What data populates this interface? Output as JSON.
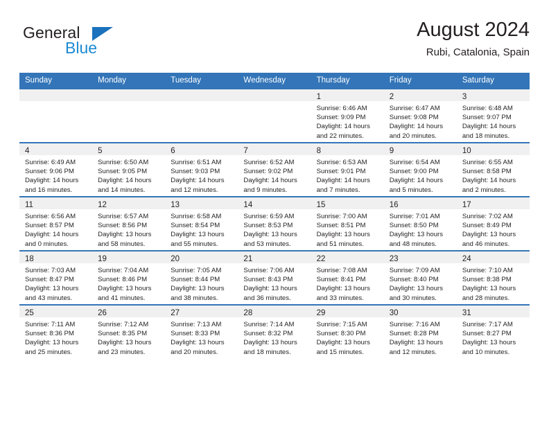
{
  "brand": {
    "name_top": "General",
    "name_bottom": "Blue",
    "accent_color": "#1c72bc",
    "blue_text_color": "#1c8ad1"
  },
  "header": {
    "title": "August 2024",
    "subtitle": "Rubi, Catalonia, Spain"
  },
  "table": {
    "header_bg": "#3375b8",
    "header_text_color": "#ffffff",
    "daynum_band_bg": "#f0f0f0",
    "weekday_headers": [
      "Sunday",
      "Monday",
      "Tuesday",
      "Wednesday",
      "Thursday",
      "Friday",
      "Saturday"
    ]
  },
  "weeks": [
    [
      {
        "empty": true
      },
      {
        "empty": true
      },
      {
        "empty": true
      },
      {
        "empty": true
      },
      {
        "day": "1",
        "sunrise": "Sunrise: 6:46 AM",
        "sunset": "Sunset: 9:09 PM",
        "daylight_1": "Daylight: 14 hours",
        "daylight_2": "and 22 minutes."
      },
      {
        "day": "2",
        "sunrise": "Sunrise: 6:47 AM",
        "sunset": "Sunset: 9:08 PM",
        "daylight_1": "Daylight: 14 hours",
        "daylight_2": "and 20 minutes."
      },
      {
        "day": "3",
        "sunrise": "Sunrise: 6:48 AM",
        "sunset": "Sunset: 9:07 PM",
        "daylight_1": "Daylight: 14 hours",
        "daylight_2": "and 18 minutes."
      }
    ],
    [
      {
        "day": "4",
        "sunrise": "Sunrise: 6:49 AM",
        "sunset": "Sunset: 9:06 PM",
        "daylight_1": "Daylight: 14 hours",
        "daylight_2": "and 16 minutes."
      },
      {
        "day": "5",
        "sunrise": "Sunrise: 6:50 AM",
        "sunset": "Sunset: 9:05 PM",
        "daylight_1": "Daylight: 14 hours",
        "daylight_2": "and 14 minutes."
      },
      {
        "day": "6",
        "sunrise": "Sunrise: 6:51 AM",
        "sunset": "Sunset: 9:03 PM",
        "daylight_1": "Daylight: 14 hours",
        "daylight_2": "and 12 minutes."
      },
      {
        "day": "7",
        "sunrise": "Sunrise: 6:52 AM",
        "sunset": "Sunset: 9:02 PM",
        "daylight_1": "Daylight: 14 hours",
        "daylight_2": "and 9 minutes."
      },
      {
        "day": "8",
        "sunrise": "Sunrise: 6:53 AM",
        "sunset": "Sunset: 9:01 PM",
        "daylight_1": "Daylight: 14 hours",
        "daylight_2": "and 7 minutes."
      },
      {
        "day": "9",
        "sunrise": "Sunrise: 6:54 AM",
        "sunset": "Sunset: 9:00 PM",
        "daylight_1": "Daylight: 14 hours",
        "daylight_2": "and 5 minutes."
      },
      {
        "day": "10",
        "sunrise": "Sunrise: 6:55 AM",
        "sunset": "Sunset: 8:58 PM",
        "daylight_1": "Daylight: 14 hours",
        "daylight_2": "and 2 minutes."
      }
    ],
    [
      {
        "day": "11",
        "sunrise": "Sunrise: 6:56 AM",
        "sunset": "Sunset: 8:57 PM",
        "daylight_1": "Daylight: 14 hours",
        "daylight_2": "and 0 minutes."
      },
      {
        "day": "12",
        "sunrise": "Sunrise: 6:57 AM",
        "sunset": "Sunset: 8:56 PM",
        "daylight_1": "Daylight: 13 hours",
        "daylight_2": "and 58 minutes."
      },
      {
        "day": "13",
        "sunrise": "Sunrise: 6:58 AM",
        "sunset": "Sunset: 8:54 PM",
        "daylight_1": "Daylight: 13 hours",
        "daylight_2": "and 55 minutes."
      },
      {
        "day": "14",
        "sunrise": "Sunrise: 6:59 AM",
        "sunset": "Sunset: 8:53 PM",
        "daylight_1": "Daylight: 13 hours",
        "daylight_2": "and 53 minutes."
      },
      {
        "day": "15",
        "sunrise": "Sunrise: 7:00 AM",
        "sunset": "Sunset: 8:51 PM",
        "daylight_1": "Daylight: 13 hours",
        "daylight_2": "and 51 minutes."
      },
      {
        "day": "16",
        "sunrise": "Sunrise: 7:01 AM",
        "sunset": "Sunset: 8:50 PM",
        "daylight_1": "Daylight: 13 hours",
        "daylight_2": "and 48 minutes."
      },
      {
        "day": "17",
        "sunrise": "Sunrise: 7:02 AM",
        "sunset": "Sunset: 8:49 PM",
        "daylight_1": "Daylight: 13 hours",
        "daylight_2": "and 46 minutes."
      }
    ],
    [
      {
        "day": "18",
        "sunrise": "Sunrise: 7:03 AM",
        "sunset": "Sunset: 8:47 PM",
        "daylight_1": "Daylight: 13 hours",
        "daylight_2": "and 43 minutes."
      },
      {
        "day": "19",
        "sunrise": "Sunrise: 7:04 AM",
        "sunset": "Sunset: 8:46 PM",
        "daylight_1": "Daylight: 13 hours",
        "daylight_2": "and 41 minutes."
      },
      {
        "day": "20",
        "sunrise": "Sunrise: 7:05 AM",
        "sunset": "Sunset: 8:44 PM",
        "daylight_1": "Daylight: 13 hours",
        "daylight_2": "and 38 minutes."
      },
      {
        "day": "21",
        "sunrise": "Sunrise: 7:06 AM",
        "sunset": "Sunset: 8:43 PM",
        "daylight_1": "Daylight: 13 hours",
        "daylight_2": "and 36 minutes."
      },
      {
        "day": "22",
        "sunrise": "Sunrise: 7:08 AM",
        "sunset": "Sunset: 8:41 PM",
        "daylight_1": "Daylight: 13 hours",
        "daylight_2": "and 33 minutes."
      },
      {
        "day": "23",
        "sunrise": "Sunrise: 7:09 AM",
        "sunset": "Sunset: 8:40 PM",
        "daylight_1": "Daylight: 13 hours",
        "daylight_2": "and 30 minutes."
      },
      {
        "day": "24",
        "sunrise": "Sunrise: 7:10 AM",
        "sunset": "Sunset: 8:38 PM",
        "daylight_1": "Daylight: 13 hours",
        "daylight_2": "and 28 minutes."
      }
    ],
    [
      {
        "day": "25",
        "sunrise": "Sunrise: 7:11 AM",
        "sunset": "Sunset: 8:36 PM",
        "daylight_1": "Daylight: 13 hours",
        "daylight_2": "and 25 minutes."
      },
      {
        "day": "26",
        "sunrise": "Sunrise: 7:12 AM",
        "sunset": "Sunset: 8:35 PM",
        "daylight_1": "Daylight: 13 hours",
        "daylight_2": "and 23 minutes."
      },
      {
        "day": "27",
        "sunrise": "Sunrise: 7:13 AM",
        "sunset": "Sunset: 8:33 PM",
        "daylight_1": "Daylight: 13 hours",
        "daylight_2": "and 20 minutes."
      },
      {
        "day": "28",
        "sunrise": "Sunrise: 7:14 AM",
        "sunset": "Sunset: 8:32 PM",
        "daylight_1": "Daylight: 13 hours",
        "daylight_2": "and 18 minutes."
      },
      {
        "day": "29",
        "sunrise": "Sunrise: 7:15 AM",
        "sunset": "Sunset: 8:30 PM",
        "daylight_1": "Daylight: 13 hours",
        "daylight_2": "and 15 minutes."
      },
      {
        "day": "30",
        "sunrise": "Sunrise: 7:16 AM",
        "sunset": "Sunset: 8:28 PM",
        "daylight_1": "Daylight: 13 hours",
        "daylight_2": "and 12 minutes."
      },
      {
        "day": "31",
        "sunrise": "Sunrise: 7:17 AM",
        "sunset": "Sunset: 8:27 PM",
        "daylight_1": "Daylight: 13 hours",
        "daylight_2": "and 10 minutes."
      }
    ]
  ]
}
